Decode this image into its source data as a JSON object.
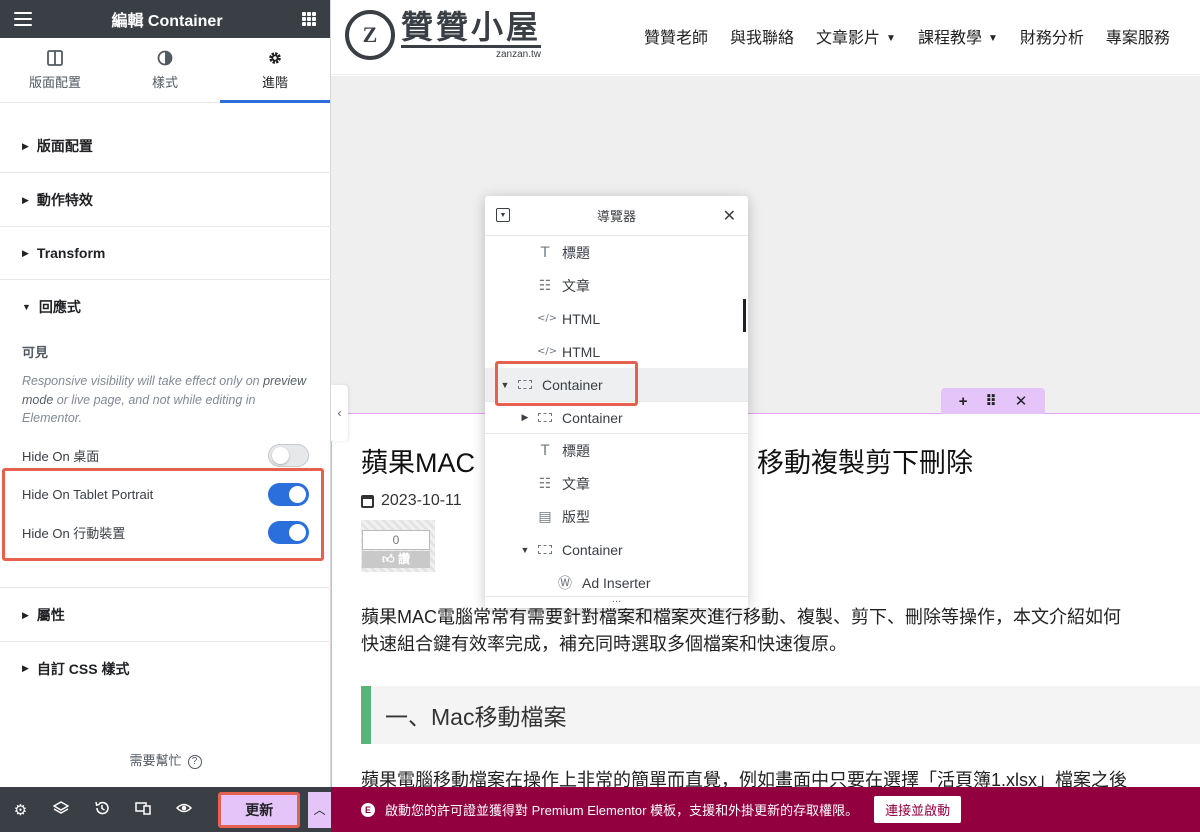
{
  "panel": {
    "title": "編輯 Container",
    "tabs": [
      {
        "label": "版面配置",
        "icon": "layout-icon"
      },
      {
        "label": "樣式",
        "icon": "contrast-icon"
      },
      {
        "label": "進階",
        "icon": "gear-icon"
      }
    ],
    "sections": {
      "layout": "版面配置",
      "motion": "動作特效",
      "transform": "Transform",
      "responsive": "回應式",
      "attributes": "屬性",
      "custom_css": "自訂 CSS 樣式"
    },
    "responsive": {
      "visible_label": "可見",
      "note_before": "Responsive visibility will take effect only on ",
      "note_link": "preview mode",
      "note_after": " or live page, and not while editing in Elementor.",
      "toggles": [
        {
          "label": "Hide On 桌面",
          "state": "off"
        },
        {
          "label": "Hide On Tablet Portrait",
          "state": "on"
        },
        {
          "label": "Hide On 行動裝置",
          "state": "on"
        }
      ]
    },
    "help": "需要幫忙",
    "footer": {
      "update_label": "更新",
      "icons": [
        "gear-icon",
        "layers-icon",
        "history-icon",
        "responsive-icon",
        "eye-icon"
      ]
    }
  },
  "site": {
    "logo_mark": "Z",
    "logo_name": "贊贊小屋",
    "logo_domain": "zanzan.tw",
    "nav": [
      "贊贊老師",
      "與我聯絡",
      "文章影片",
      "課程教學",
      "財務分析",
      "專案服務"
    ]
  },
  "post": {
    "title_start": "蘋果MAC",
    "title_end": "移動複製剪下刪除",
    "date": "2023-10-11",
    "like_count": "0",
    "like_label": "讚",
    "intro_line1": "蘋果MAC電腦常常有需要針對檔案和檔案夾進行移動、複製、剪下、刪除等操作，本文介紹如何",
    "intro_line2": "快速組合鍵有效率完成，補充同時選取多個檔案和快速復原。",
    "h2": "一、Mac移動檔案",
    "body": "蘋果電腦移動檔案在操作上非常的簡單而直覺，例如畫面中只要在選擇「活頁簿1.xlsx」檔案之後"
  },
  "navigator": {
    "title": "導覽器",
    "items": [
      {
        "label": "標題",
        "icon": "heading-icon",
        "indent": 2,
        "arrow": ""
      },
      {
        "label": "文章",
        "icon": "posts-icon",
        "indent": 2,
        "arrow": ""
      },
      {
        "label": "HTML",
        "icon": "code-icon",
        "indent": 2,
        "arrow": ""
      },
      {
        "label": "HTML",
        "icon": "code-icon",
        "indent": 2,
        "arrow": ""
      },
      {
        "label": "Container",
        "icon": "container-icon",
        "indent": 1,
        "arrow": "▼"
      },
      {
        "label": "Container",
        "icon": "container-icon",
        "indent": 2,
        "arrow": "▶"
      },
      {
        "label": "標題",
        "icon": "heading-icon",
        "indent": 2,
        "arrow": ""
      },
      {
        "label": "文章",
        "icon": "posts-icon",
        "indent": 2,
        "arrow": ""
      },
      {
        "label": "版型",
        "icon": "template-icon",
        "indent": 2,
        "arrow": ""
      },
      {
        "label": "Container",
        "icon": "container-icon",
        "indent": 2,
        "arrow": "▼"
      },
      {
        "label": "Ad Inserter",
        "icon": "wordpress-icon",
        "indent": 3,
        "arrow": ""
      }
    ]
  },
  "promo": {
    "text": "啟動您的許可證並獲得對 Premium Elementor 模板，支援和外掛更新的存取權限。",
    "button": "連接並啟動"
  }
}
